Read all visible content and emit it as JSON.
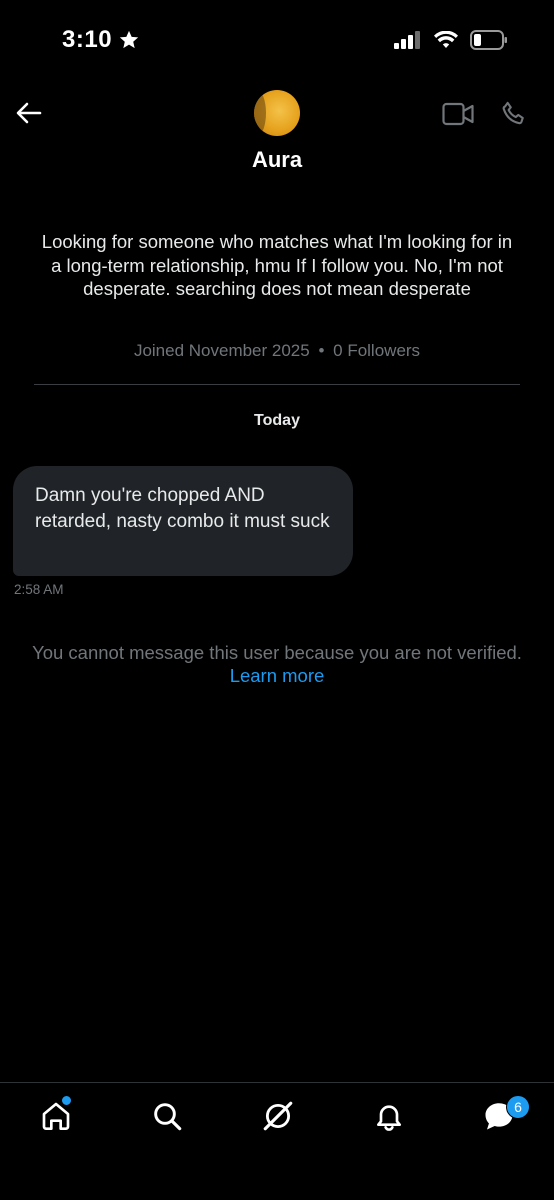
{
  "status_bar": {
    "time": "3:10",
    "time_icon": "star-icon",
    "icons": [
      "cellular-signal-icon",
      "wifi-icon",
      "battery-icon"
    ]
  },
  "header": {
    "contact_name": "Aura",
    "icons": [
      "back-arrow-icon",
      "video-camera-icon",
      "phone-icon"
    ]
  },
  "profile": {
    "bio": "Looking for someone who matches what I'm looking for in a long-term relationship, hmu If I follow you. No, I'm not desperate. searching does not mean desperate",
    "joined": "Joined November 2025",
    "separator": "•",
    "followers": "0 Followers"
  },
  "conversation": {
    "date_label": "Today",
    "messages": [
      {
        "text": "Damn you're chopped AND retarded, nasty combo it must suck",
        "time": "2:58 AM",
        "direction": "incoming"
      }
    ]
  },
  "notice": {
    "text": "You cannot message this user because you are not verified.",
    "link": "Learn more"
  },
  "bottom_nav": {
    "items": [
      "home-icon",
      "search-icon",
      "grok-icon",
      "notifications-bell-icon",
      "messages-icon"
    ],
    "messages_badge": "6"
  },
  "colors": {
    "background": "#000000",
    "accent": "#1d9bf0",
    "bubble": "#202327",
    "muted_text": "#71767b"
  }
}
